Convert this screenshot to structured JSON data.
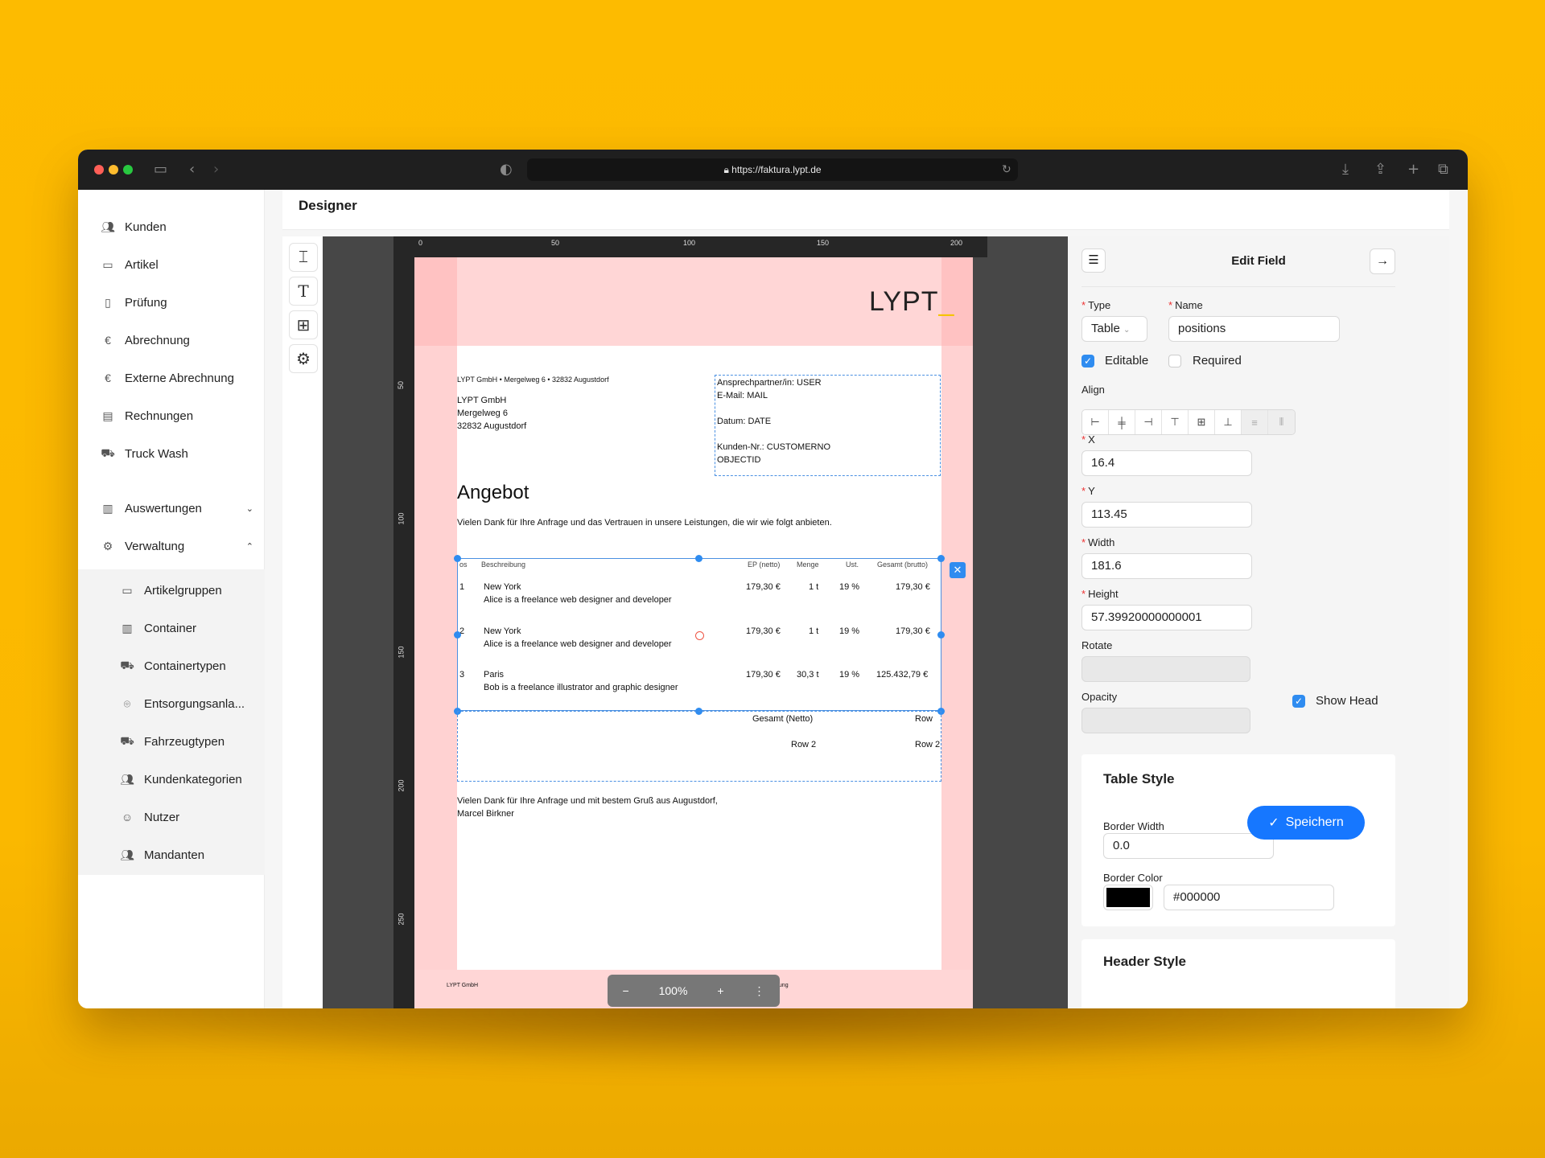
{
  "browser": {
    "url": "https://faktura.lypt.de"
  },
  "sidebar": {
    "items": [
      {
        "label": "Kunden",
        "icon": "users-icon"
      },
      {
        "label": "Artikel",
        "icon": "calendar-icon"
      },
      {
        "label": "Prüfung",
        "icon": "file-icon"
      },
      {
        "label": "Abrechnung",
        "icon": "euro-icon"
      },
      {
        "label": "Externe Abrechnung",
        "icon": "euro-icon"
      },
      {
        "label": "Rechnungen",
        "icon": "receipt-icon"
      },
      {
        "label": "Truck Wash",
        "icon": "car-wash-icon"
      },
      {
        "label": "Auswertungen",
        "icon": "library-icon"
      },
      {
        "label": "Verwaltung",
        "icon": "gear-icon"
      }
    ],
    "subitems": [
      {
        "label": "Artikelgruppen",
        "icon": "calendar-icon"
      },
      {
        "label": "Container",
        "icon": "container-icon"
      },
      {
        "label": "Containertypen",
        "icon": "truck-icon"
      },
      {
        "label": "Entsorgungsanla...",
        "icon": "map-pin-icon"
      },
      {
        "label": "Fahrzeugtypen",
        "icon": "truck-icon"
      },
      {
        "label": "Kundenkategorien",
        "icon": "users-icon"
      },
      {
        "label": "Nutzer",
        "icon": "user-icon"
      },
      {
        "label": "Mandanten",
        "icon": "users-icon"
      }
    ]
  },
  "page": {
    "title": "Designer"
  },
  "ruler": {
    "top": [
      "0",
      "50",
      "100",
      "150",
      "200"
    ],
    "left": [
      "50",
      "100",
      "150",
      "200",
      "250"
    ]
  },
  "doc": {
    "logo": "LYPT",
    "sender_line": "LYPT GmbH • Mergelweg 6 • 32832 Augustdorf",
    "address": [
      "LYPT GmbH",
      "Mergelweg 6",
      "32832 Augustdorf"
    ],
    "info": [
      "Ansprechpartner/in: USER",
      "E-Mail: MAIL",
      "Datum: DATE",
      "Kunden-Nr.: CUSTOMERNO",
      "OBJECTID"
    ],
    "heading": "Angebot",
    "intro": "Vielen Dank für Ihre Anfrage und das Vertrauen in unsere Leistungen, die wir wie folgt anbieten.",
    "table_headers": [
      "os",
      "Beschreibung",
      "EP (netto)",
      "Menge",
      "Ust.",
      "Gesamt (brutto)"
    ],
    "rows": [
      {
        "pos": "1",
        "title": "New York",
        "desc": "Alice is a freelance web designer and developer",
        "ep": "179,30 €",
        "qty": "1 t",
        "vat": "19 %",
        "total": "179,30 €"
      },
      {
        "pos": "2",
        "title": "New York",
        "desc": "Alice is a freelance web designer and developer",
        "ep": "179,30 €",
        "qty": "1 t",
        "vat": "19 %",
        "total": "179,30 €"
      },
      {
        "pos": "3",
        "title": "Paris",
        "desc": "Bob is a freelance illustrator and graphic designer",
        "ep": "179,30 €",
        "qty": "30,3 t",
        "vat": "19 %",
        "total": "125.432,79 €"
      }
    ],
    "summary": {
      "label": "Gesamt (Netto)",
      "head2": "Row",
      "row_a": "Row 2",
      "row_b": "Row 2"
    },
    "closing": [
      "Vielen Dank für Ihre Anfrage und mit bestem Gruß aus Augustdorf,",
      "Marcel Birkner"
    ],
    "footer": {
      "left": "LYPT GmbH",
      "right": "Bankverbindung"
    },
    "zoom": "100%"
  },
  "panel": {
    "title": "Edit Field",
    "type_label": "Type",
    "type_value": "Table",
    "name_label": "Name",
    "name_value": "positions",
    "editable_label": "Editable",
    "required_label": "Required",
    "align_label": "Align",
    "x_label": "X",
    "x_value": "16.4",
    "y_label": "Y",
    "y_value": "113.45",
    "width_label": "Width",
    "width_value": "181.6",
    "height_label": "Height",
    "height_value": "57.39920000000001",
    "rotate_label": "Rotate",
    "opacity_label": "Opacity",
    "show_head_label": "Show Head",
    "table_style": {
      "title": "Table Style",
      "border_width_label": "Border Width",
      "border_width_value": "0.0",
      "border_color_label": "Border Color",
      "border_color_value": "#000000"
    },
    "header_style": {
      "title": "Header Style"
    }
  },
  "save": {
    "label": "Speichern"
  },
  "colors": {
    "accent": "#1677ff",
    "margin": "#ffd6d6",
    "logo_accent": "#f5c400",
    "background": "#FDBB00"
  }
}
